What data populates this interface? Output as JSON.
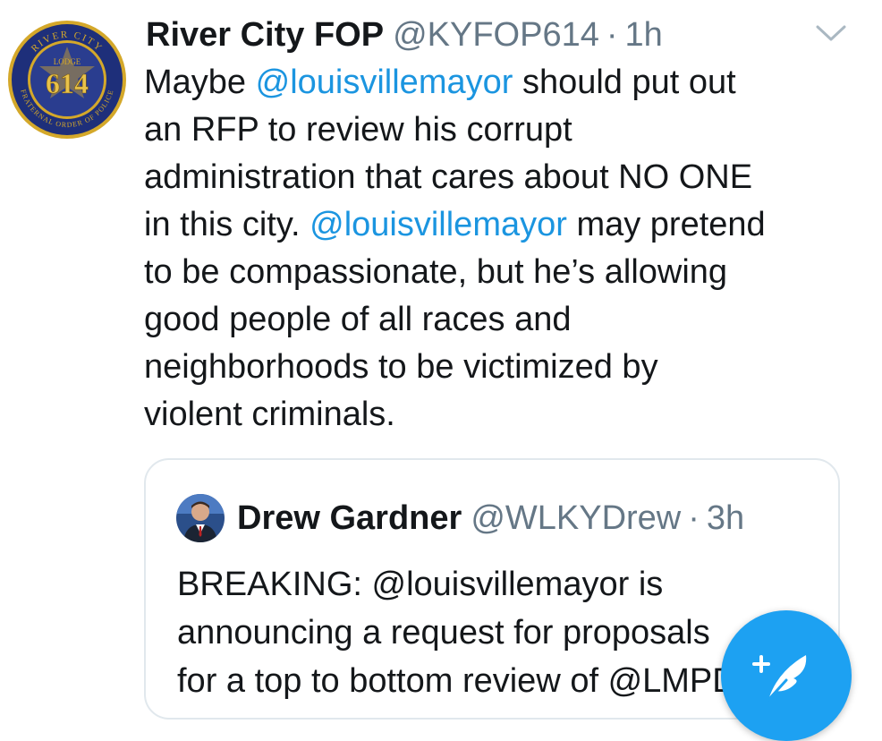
{
  "tweet": {
    "display_name": "River City FOP",
    "handle": "@KYFOP614",
    "separator": "·",
    "timestamp": "1h",
    "avatar": {
      "ring_top_text": "RIVER CITY",
      "ring_bottom_text": "FRATERNAL ORDER OF POLICE",
      "center_number": "614",
      "inner_text": "LODGE",
      "colors": {
        "ring": "#1e2f7a",
        "gold": "#d4a82a"
      }
    },
    "text_segments": [
      {
        "text": "Maybe ",
        "type": "text"
      },
      {
        "text": "@louisvillemayor",
        "type": "mention"
      },
      {
        "text": " should put out\nan RFP to review his corrupt\nadministration that cares about NO ONE\nin this city. ",
        "type": "text"
      },
      {
        "text": "@louisvillemayor",
        "type": "mention"
      },
      {
        "text": " may pretend\nto be compassionate, but he’s allowing\ngood people of all races and\nneighborhoods to be victimized by\nviolent criminals.",
        "type": "text"
      }
    ],
    "menu_icon": "chevron-down-icon"
  },
  "quoted_tweet": {
    "display_name": "Drew Gardner",
    "handle": "@WLKYDrew",
    "separator": "·",
    "timestamp": "3h",
    "text": "BREAKING: @louisvillemayor is\nannouncing a request for proposals\nfor a top to bottom review of @LMPD"
  },
  "compose_button": {
    "icon": "compose-feather-icon",
    "color": "#1da1f2"
  },
  "colors": {
    "mention": "#1b95e0",
    "secondary_text": "#657786",
    "primary_text": "#14171a",
    "border": "#e1e8ed"
  }
}
